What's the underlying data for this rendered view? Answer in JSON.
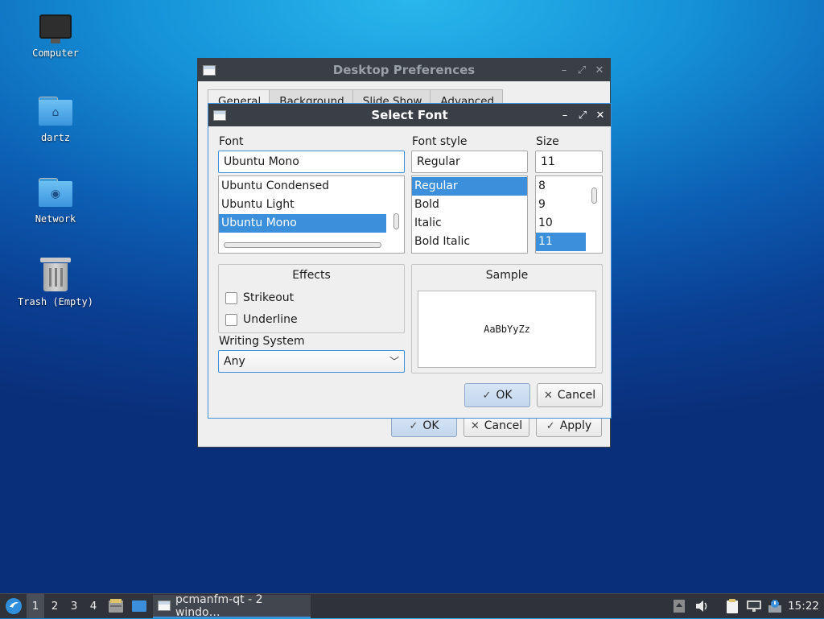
{
  "desktop": {
    "icons": [
      {
        "label": "Computer"
      },
      {
        "label": "dartz"
      },
      {
        "label": "Network"
      },
      {
        "label": "Trash (Empty)"
      }
    ]
  },
  "desktop_prefs": {
    "title": "Desktop Preferences",
    "tabs": [
      "General",
      "Background",
      "Slide Show",
      "Advanced"
    ],
    "ok_label": "OK",
    "cancel_label": "Cancel",
    "apply_label": "Apply"
  },
  "select_font": {
    "title": "Select Font",
    "font_label": "Font",
    "font_value": "Ubuntu Mono",
    "font_list": [
      "Ubuntu Condensed",
      "Ubuntu Light",
      "Ubuntu Mono"
    ],
    "style_label": "Font style",
    "style_value": "Regular",
    "style_list": [
      "Regular",
      "Bold",
      "Italic",
      "Bold Italic"
    ],
    "size_label": "Size",
    "size_value": "11",
    "size_list": [
      "8",
      "9",
      "10",
      "11"
    ],
    "effects_title": "Effects",
    "strikeout_label": "Strikeout",
    "underline_label": "Underline",
    "sample_title": "Sample",
    "sample_text": "AaBbYyZz",
    "writing_system_label": "Writing System",
    "writing_system_value": "Any",
    "ok_label": "OK",
    "cancel_label": "Cancel"
  },
  "taskbar": {
    "workspaces": [
      "1",
      "2",
      "3",
      "4"
    ],
    "task_label": "pcmanfm-qt - 2 windo…",
    "clock": "15:22"
  },
  "colors": {
    "selection": "#3b8fdb",
    "titlebar": "#3a3e45",
    "taskbar": "#2f3238"
  }
}
